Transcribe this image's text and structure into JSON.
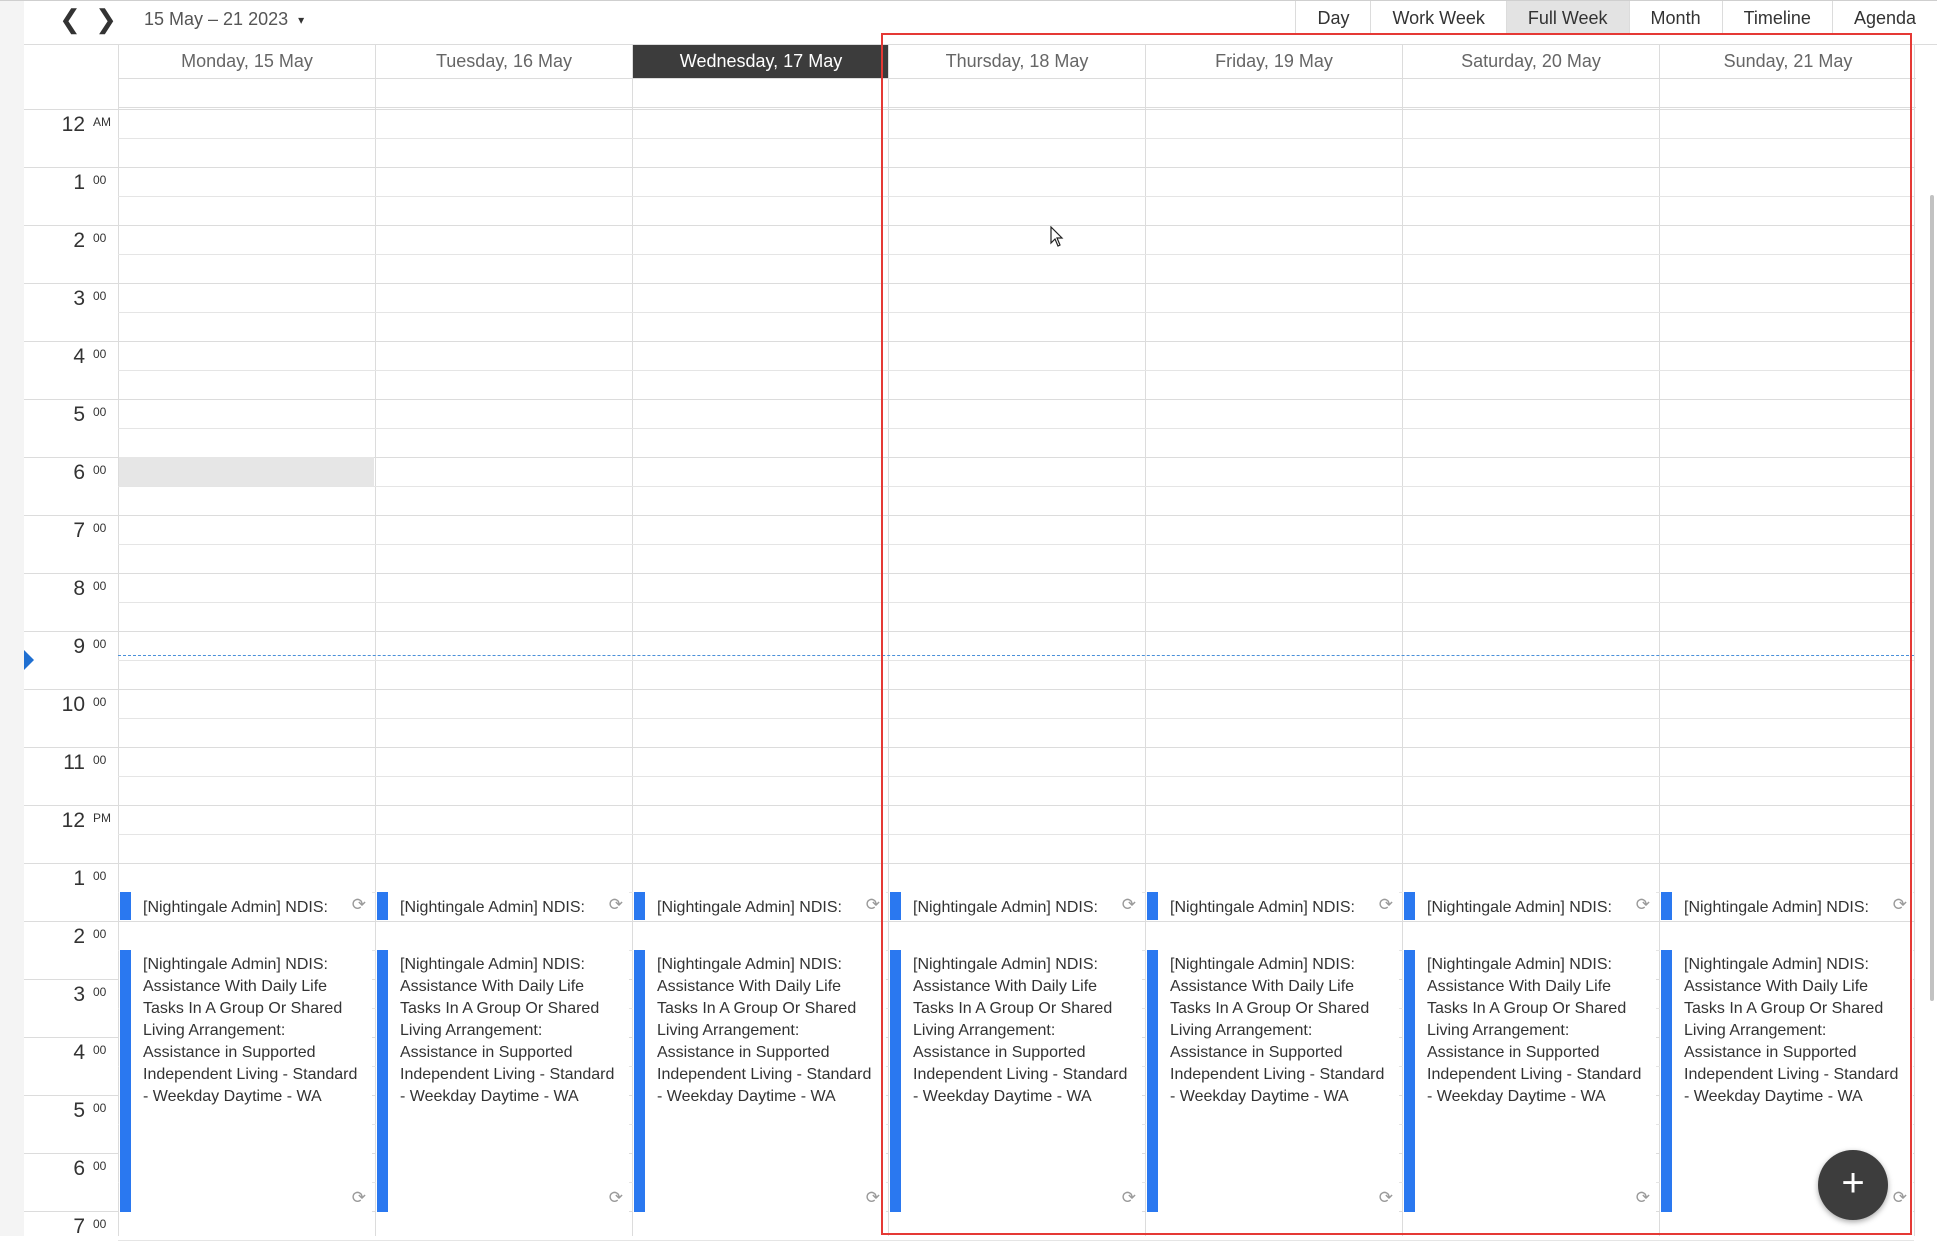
{
  "toolbar": {
    "prev_icon": "chevron-left-icon",
    "next_icon": "chevron-right-icon",
    "prev_glyph": "❮",
    "next_glyph": "❯",
    "date_range": "15 May – 21 2023",
    "dropdown_glyph": "▾",
    "views": [
      "Day",
      "Work Week",
      "Full Week",
      "Month",
      "Timeline",
      "Agenda"
    ],
    "active_view": "Full Week"
  },
  "days": [
    {
      "label": "Monday, 15 May",
      "today": false
    },
    {
      "label": "Tuesday, 16 May",
      "today": false
    },
    {
      "label": "Wednesday, 17 May",
      "today": true
    },
    {
      "label": "Thursday, 18 May",
      "today": false
    },
    {
      "label": "Friday, 19 May",
      "today": false
    },
    {
      "label": "Saturday, 20 May",
      "today": false
    },
    {
      "label": "Sunday, 21 May",
      "today": false
    }
  ],
  "hours": [
    {
      "h": "12",
      "s": "AM"
    },
    {
      "h": "1",
      "s": "00"
    },
    {
      "h": "2",
      "s": "00"
    },
    {
      "h": "3",
      "s": "00"
    },
    {
      "h": "4",
      "s": "00"
    },
    {
      "h": "5",
      "s": "00"
    },
    {
      "h": "6",
      "s": "00"
    },
    {
      "h": "7",
      "s": "00"
    },
    {
      "h": "8",
      "s": "00"
    },
    {
      "h": "9",
      "s": "00"
    },
    {
      "h": "10",
      "s": "00"
    },
    {
      "h": "11",
      "s": "00"
    },
    {
      "h": "12",
      "s": "PM"
    },
    {
      "h": "1",
      "s": "00"
    },
    {
      "h": "2",
      "s": "00"
    },
    {
      "h": "3",
      "s": "00"
    },
    {
      "h": "4",
      "s": "00"
    },
    {
      "h": "5",
      "s": "00"
    },
    {
      "h": "6",
      "s": "00"
    },
    {
      "h": "7",
      "s": "00"
    }
  ],
  "events": {
    "short_title": "[Nightingale Admin] NDIS:",
    "long_lines": [
      "[Nightingale Admin] NDIS:",
      "Assistance With Daily Life",
      "Tasks In A Group Or Shared",
      "Living Arrangement:",
      "Assistance in Supported",
      "Independent Living - Standard",
      "- Weekday Daytime - WA"
    ],
    "recurrence_icon": "recurrence-icon",
    "recurrence_glyph": "⟳",
    "color": "#2a78f0"
  },
  "fab": {
    "icon": "add-icon",
    "glyph": "+"
  },
  "colors": {
    "today_header": "#3c3c3c",
    "annotation_box": "#e53935",
    "now_line": "#4a90d9"
  }
}
